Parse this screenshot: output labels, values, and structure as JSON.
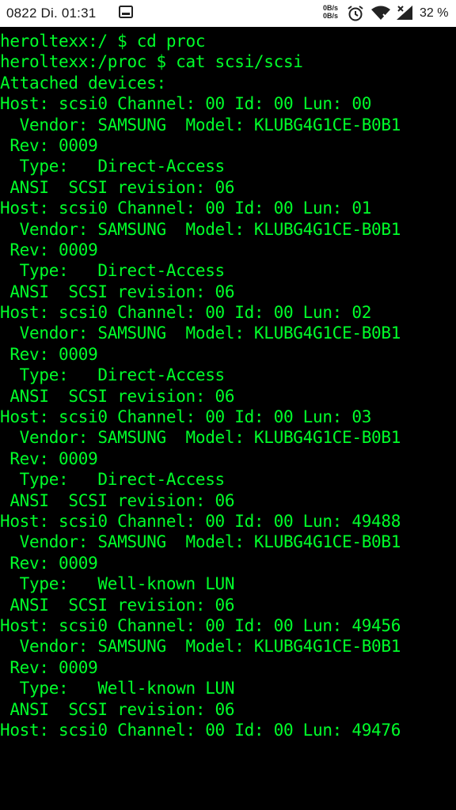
{
  "status_bar": {
    "time": "0822 Di. 01:31",
    "net_speed_up": "0B/s",
    "net_speed_down": "0B/s",
    "battery": "32 %",
    "icons": [
      "screenshot-icon",
      "alarm-icon",
      "wifi-icon",
      "signal-icon"
    ]
  },
  "terminal": {
    "text_color": "#00ff2a",
    "background": "#000000",
    "lines": [
      "heroltexx:/ $ cd proc",
      "heroltexx:/proc $ cat scsi/scsi",
      "Attached devices:",
      "Host: scsi0 Channel: 00 Id: 00 Lun: 00",
      "  Vendor: SAMSUNG  Model: KLUBG4G1CE-B0B1",
      " Rev: 0009",
      "  Type:   Direct-Access",
      " ANSI  SCSI revision: 06",
      "Host: scsi0 Channel: 00 Id: 00 Lun: 01",
      "  Vendor: SAMSUNG  Model: KLUBG4G1CE-B0B1",
      " Rev: 0009",
      "  Type:   Direct-Access",
      " ANSI  SCSI revision: 06",
      "Host: scsi0 Channel: 00 Id: 00 Lun: 02",
      "  Vendor: SAMSUNG  Model: KLUBG4G1CE-B0B1",
      " Rev: 0009",
      "  Type:   Direct-Access",
      " ANSI  SCSI revision: 06",
      "Host: scsi0 Channel: 00 Id: 00 Lun: 03",
      "  Vendor: SAMSUNG  Model: KLUBG4G1CE-B0B1",
      " Rev: 0009",
      "  Type:   Direct-Access",
      " ANSI  SCSI revision: 06",
      "Host: scsi0 Channel: 00 Id: 00 Lun: 49488",
      "  Vendor: SAMSUNG  Model: KLUBG4G1CE-B0B1",
      " Rev: 0009",
      "  Type:   Well-known LUN",
      " ANSI  SCSI revision: 06",
      "Host: scsi0 Channel: 00 Id: 00 Lun: 49456",
      "  Vendor: SAMSUNG  Model: KLUBG4G1CE-B0B1",
      " Rev: 0009",
      "  Type:   Well-known LUN",
      " ANSI  SCSI revision: 06",
      "Host: scsi0 Channel: 00 Id: 00 Lun: 49476"
    ]
  }
}
